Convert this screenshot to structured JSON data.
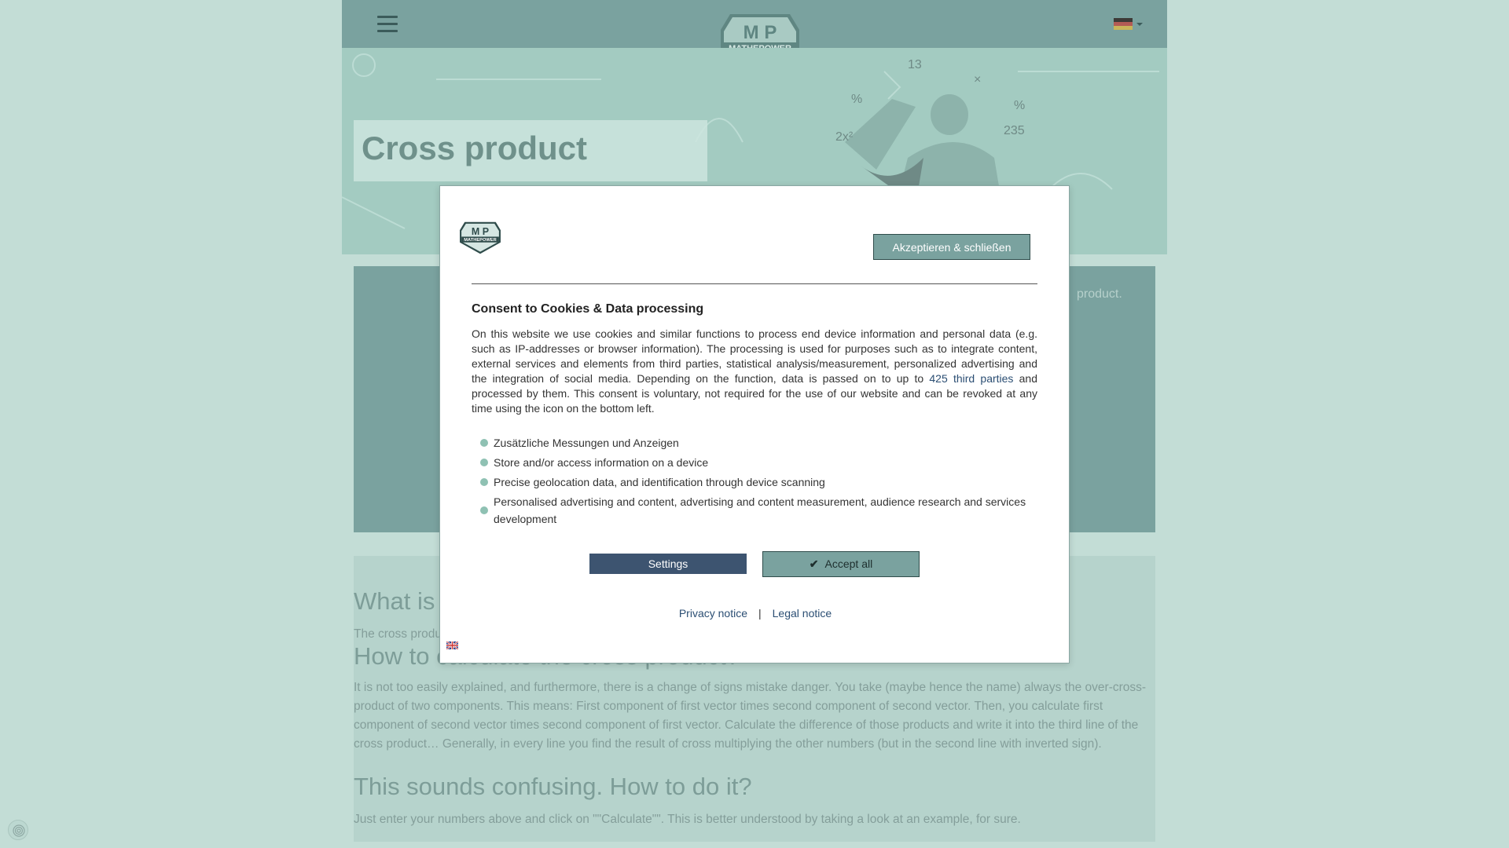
{
  "header": {
    "logo_top_text": "M P",
    "logo_bottom_text": "MATHEPOWER",
    "language_flag": "de-flag-icon"
  },
  "hero": {
    "title": "Cross product"
  },
  "tool_panel": {
    "visible_text": "product."
  },
  "content": {
    "h2_what": "What is",
    "p_what": "The cross produ",
    "h2_how": "How to calculate the cross product?",
    "p_how": "It is not too easily explained, and furthermore, there is a change of signs mistake danger. You take (maybe hence the name) always the over-cross-product of two components. This means: First component of first vector times second component of second vector. Then, you calculate first component of second vector times second component of first vector. Calculate the difference of those products and write it into the third line of the cross product… Generally, in every line you find the result of cross multiplying the other numbers (but in the second line with inverted sign).",
    "h2_confusing": "This sounds confusing. How to do it?",
    "p_confusing": "Just enter your numbers above and click on \"\"Calculate\"\". This is better understood by taking a look at an example, for sure."
  },
  "consent": {
    "accept_close_label": "Akzeptieren & schließen",
    "title": "Consent to Cookies & Data processing",
    "body_part1": "On this website we use cookies and similar functions to process end device information and personal data (e.g. such as IP-addresses or browser information). The processing is used for purposes such as to integrate content, external services and elements from third parties, statistical analysis/measurement, personalized advertising and the integration of social media. Depending on the function, data is passed on to up to ",
    "third_parties_link": "425 third parties",
    "body_part2": " and processed by them. This consent is voluntary, not required for the use of our website and can be revoked at any time using the icon on the bottom left.",
    "purposes": [
      "Zusätzliche Messungen und Anzeigen",
      "Store and/or access information on a device",
      "Precise geolocation data, and identification through device scanning",
      "Personalised advertising and content, advertising and content measurement, audience research and services development"
    ],
    "settings_label": "Settings",
    "accept_all_label": "Accept all",
    "privacy_label": "Privacy notice",
    "separator": "|",
    "legal_label": "Legal notice",
    "language_flag": "uk-flag-icon"
  },
  "colors": {
    "page_bg": "#c3ddd6",
    "nav_bg": "#7aa29f",
    "accept_button": "#7aa29f",
    "settings_button": "#3d5470",
    "purpose_dot": "#8fc1b3"
  }
}
